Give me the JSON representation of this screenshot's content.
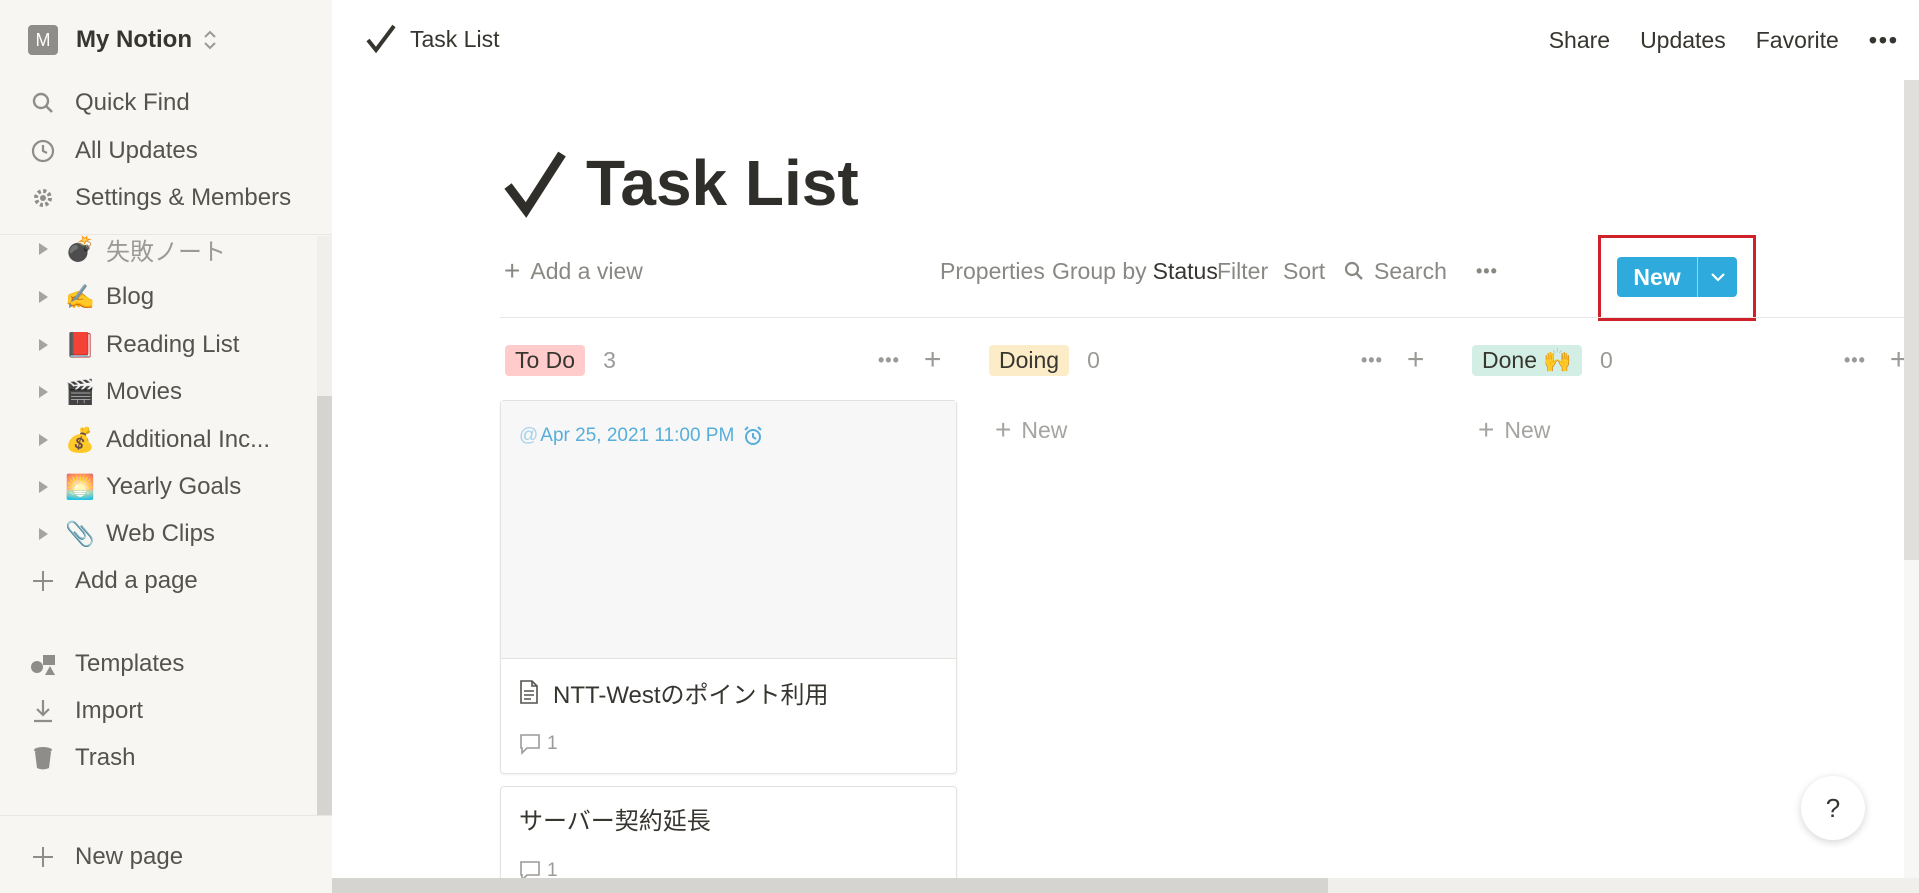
{
  "workspace": {
    "avatar_letter": "M",
    "name": "My Notion"
  },
  "sidebar": {
    "nav": [
      {
        "label": "Quick Find",
        "icon": "search-icon"
      },
      {
        "label": "All Updates",
        "icon": "clock-icon"
      },
      {
        "label": "Settings & Members",
        "icon": "gear-icon"
      }
    ],
    "pages": [
      {
        "emoji": "💣",
        "label": "失敗ノート"
      },
      {
        "emoji": "✍️",
        "label": "Blog"
      },
      {
        "emoji": "📕",
        "label": "Reading List"
      },
      {
        "emoji": "🎬",
        "label": "Movies"
      },
      {
        "emoji": "💰",
        "label": "Additional Inc..."
      },
      {
        "emoji": "🌅",
        "label": "Yearly Goals"
      },
      {
        "emoji": "📎",
        "label": "Web Clips"
      }
    ],
    "add_page": "Add a page",
    "bottom": [
      {
        "label": "Templates",
        "icon": "templates-icon"
      },
      {
        "label": "Import",
        "icon": "import-icon"
      },
      {
        "label": "Trash",
        "icon": "trash-icon"
      }
    ],
    "new_page": "New page"
  },
  "topbar": {
    "breadcrumb": "Task List",
    "share": "Share",
    "updates": "Updates",
    "favorite": "Favorite",
    "more": "•••"
  },
  "page": {
    "title": "Task List",
    "viewbar": {
      "add_view": "Add a view",
      "properties": "Properties",
      "group_by": "Group by",
      "group_by_value": "Status",
      "filter": "Filter",
      "sort": "Sort",
      "search": "Search",
      "more": "•••",
      "new": "New"
    },
    "columns": [
      {
        "tag": "To Do",
        "count": "3",
        "color": "#ffcccb"
      },
      {
        "tag": "Doing",
        "count": "0",
        "color": "#fdecc8"
      },
      {
        "tag": "Done 🙌",
        "count": "0",
        "color": "#d3efe5"
      }
    ],
    "column_new": "New",
    "cards": [
      {
        "date": "Apr 25, 2021 11:00 PM",
        "title": "NTT-Westのポイント利用",
        "comments": "1"
      },
      {
        "title": "サーバー契約延長",
        "comments": "1"
      }
    ],
    "help": "?"
  },
  "colors": {
    "accent": "#2eaadc",
    "highlight": "#d0202a"
  }
}
